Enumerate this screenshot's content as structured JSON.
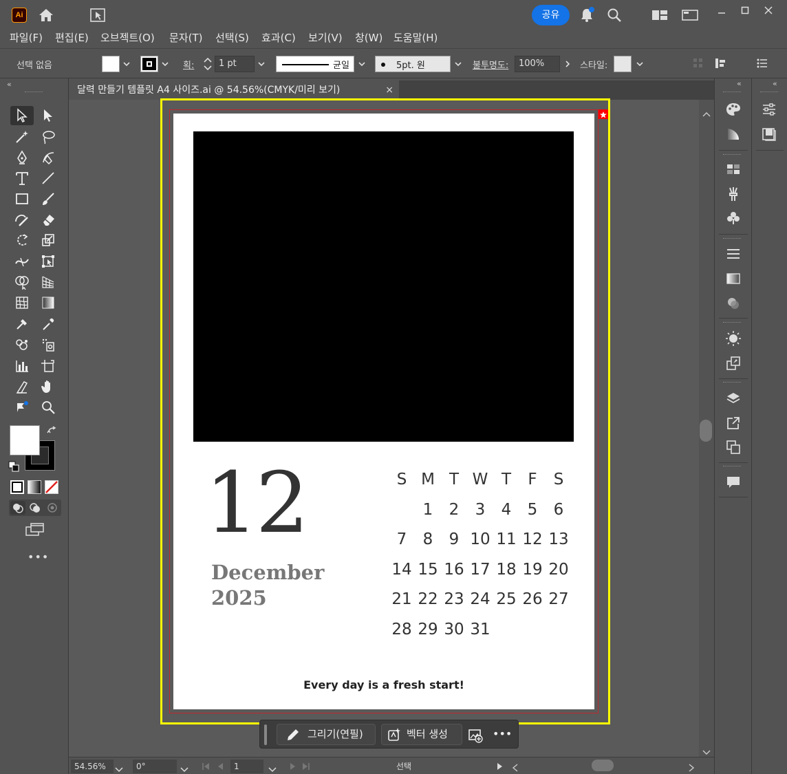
{
  "app": {
    "logo": "Ai",
    "share_label": "공유",
    "icons": [
      "home-icon",
      "arrange-documents-icon",
      "bell-icon",
      "search-icon",
      "workspace-icon",
      "panel-icon"
    ]
  },
  "menu": [
    "파일(F)",
    "편집(E)",
    "오브젝트(O)",
    "문자(T)",
    "선택(S)",
    "효과(C)",
    "보기(V)",
    "창(W)",
    "도움말(H)"
  ],
  "control_bar": {
    "selection_status": "선택 없음",
    "stroke_label": "획:",
    "stroke_weight": "1 pt",
    "stroke_profile": "균일",
    "brush": "5pt. 원",
    "opacity_label": "불투명도:",
    "opacity_value": "100%",
    "style_label": "스타일:"
  },
  "document_tab": {
    "title": "달력 만들기 템플릿 A4 사이즈.ai @ 54.56%(CMYK/미리 보기)",
    "close": "×"
  },
  "artboard": {
    "day_number": "12",
    "month": "December",
    "year": "2025",
    "calendar_header": [
      "S",
      "M",
      "T",
      "W",
      "T",
      "F",
      "S"
    ],
    "calendar_weeks": [
      [
        "",
        "1",
        "2",
        "3",
        "4",
        "5",
        "6"
      ],
      [
        "7",
        "8",
        "9",
        "10",
        "11",
        "12",
        "13"
      ],
      [
        "14",
        "15",
        "16",
        "17",
        "18",
        "19",
        "20"
      ],
      [
        "21",
        "22",
        "23",
        "24",
        "25",
        "26",
        "27"
      ],
      [
        "28",
        "29",
        "30",
        "31",
        "",
        "",
        ""
      ]
    ],
    "motto": "Every day is a fresh start!"
  },
  "context_bar": {
    "draw_label": "그리기(연필)",
    "vector_label": "벡터 생성",
    "more": "•••"
  },
  "status_bar": {
    "zoom": "54.56%",
    "rotation": "0°",
    "artboard_index": "1",
    "tool_status": "선택"
  },
  "colors": {
    "accent": "#1473e6",
    "selection_frame": "#ffff00",
    "bleed_line": "#c0272d",
    "ui_background": "#535353",
    "app_logo": "#ff9a00"
  }
}
